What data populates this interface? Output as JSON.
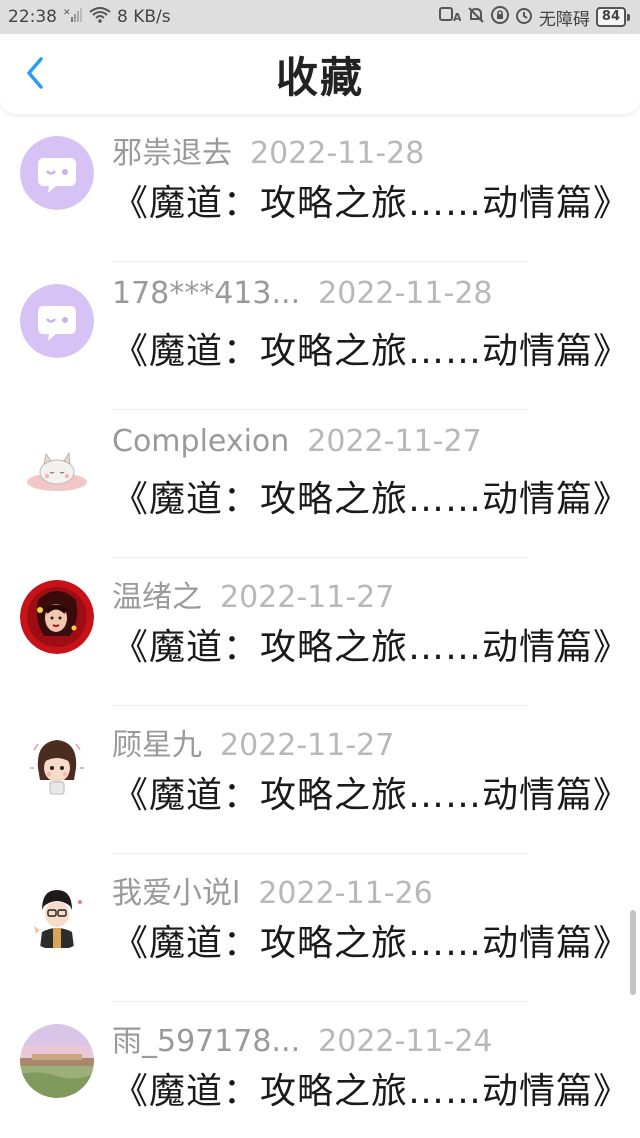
{
  "status_bar": {
    "time": "22:38",
    "net_speed": "8 KB/s",
    "accessibility": "无障碍",
    "battery": "84"
  },
  "header": {
    "title": "收藏",
    "back_icon": "chevron-left-icon"
  },
  "items": [
    {
      "user": "邪祟退去",
      "date": "2022-11-28",
      "book": "《魔道：攻略之旅……动情篇》",
      "avatar": "chat-bubble"
    },
    {
      "user": "178***413...",
      "date": "2022-11-28",
      "book": "《魔道：攻略之旅……动情篇》",
      "avatar": "chat-bubble"
    },
    {
      "user": "Complexion",
      "date": "2022-11-27",
      "book": "《魔道：攻略之旅……动情篇》",
      "avatar": "cat"
    },
    {
      "user": "温绪之",
      "date": "2022-11-27",
      "book": "《魔道：攻略之旅……动情篇》",
      "avatar": "red-portrait"
    },
    {
      "user": "顾星九",
      "date": "2022-11-27",
      "book": "《魔道：攻略之旅……动情篇》",
      "avatar": "girl"
    },
    {
      "user": "我爱小说l",
      "date": "2022-11-26",
      "book": "《魔道：攻略之旅……动情篇》",
      "avatar": "boy"
    },
    {
      "user": "雨_597178...",
      "date": "2022-11-24",
      "book": "《魔道：攻略之旅……动情篇》",
      "avatar": "landscape"
    }
  ],
  "colors": {
    "accent": "#2b9df0",
    "bubble_bg": "#d7c2f5",
    "bubble_fg": "#ffffff"
  }
}
